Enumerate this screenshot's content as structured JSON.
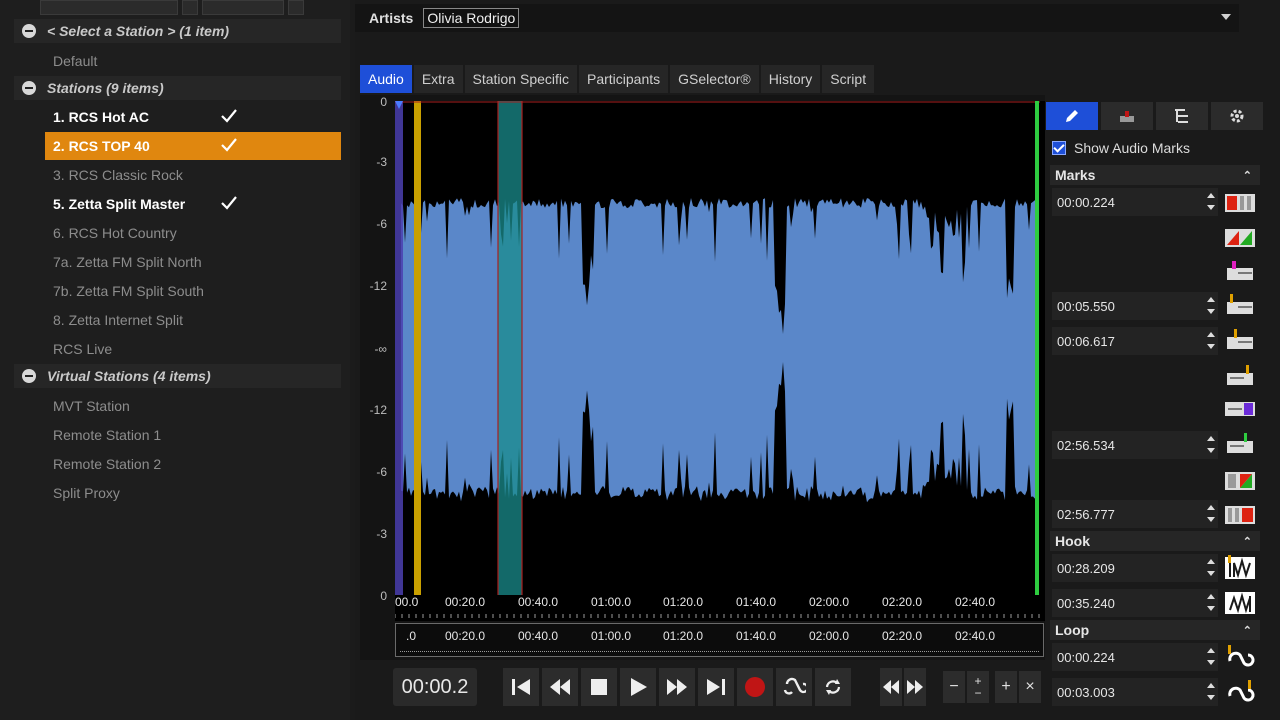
{
  "left_panel": {
    "group_select": "< Select a Station > (1 item)",
    "default_item": "Default",
    "group_stations": "Stations (9 items)",
    "stations": [
      {
        "label": "1. RCS Hot AC",
        "checked": true
      },
      {
        "label": "2. RCS TOP 40",
        "checked": true,
        "selected": true
      },
      {
        "label": "3. RCS Classic Rock",
        "checked": false
      },
      {
        "label": "5. Zetta Split Master",
        "checked": true
      },
      {
        "label": "6. RCS Hot Country",
        "checked": false
      },
      {
        "label": "7a. Zetta FM Split North",
        "checked": false
      },
      {
        "label": "7b. Zetta FM Split South",
        "checked": false
      },
      {
        "label": "8. Zetta Internet Split",
        "checked": false
      },
      {
        "label": "RCS Live",
        "checked": false
      }
    ],
    "group_virtual": "Virtual Stations (4 items)",
    "virtual_stations": [
      "MVT Station",
      "Remote Station 1",
      "Remote Station 2",
      "Split Proxy"
    ]
  },
  "artists": {
    "label": "Artists",
    "value": "Olivia Rodrigo"
  },
  "tabs": [
    "Audio",
    "Extra",
    "Station Specific",
    "Participants",
    "GSelector®",
    "History",
    "Script"
  ],
  "active_tab": "Audio",
  "waveform": {
    "y_labels": [
      "0",
      "-3",
      "-6",
      "-12",
      "-∞",
      "-12",
      "-6",
      "-3",
      "0"
    ],
    "time_labels": [
      "00.0",
      "00:20.0",
      "00:40.0",
      "01:00.0",
      "01:20.0",
      "01:40.0",
      "02:00.0",
      "02:20.0",
      "02:40.0"
    ],
    "lower_time_labels": [
      ".0",
      "00:20.0",
      "00:40.0",
      "01:00.0",
      "01:20.0",
      "01:40.0",
      "02:00.0",
      "02:20.0",
      "02:40.0"
    ],
    "colors": {
      "wave": "#5a87c9",
      "hook": "#1a8c8c",
      "loop": "#c9a000",
      "end": "#2ecc40",
      "boundary": "#aa1f1f"
    }
  },
  "transport": {
    "time": "00:00.2",
    "zoom_minus": "−",
    "zoom_plus": "+",
    "zoom_plus_small": "+",
    "zoom_minus_small": "−",
    "close": "×"
  },
  "right_panel": {
    "show_audio_marks": "Show Audio Marks",
    "marks_header": "Marks",
    "marks": [
      "00:00.224",
      "00:05.550",
      "00:06.617",
      "02:56.534",
      "02:56.777"
    ],
    "hook_header": "Hook",
    "hooks": [
      "00:28.209",
      "00:35.240"
    ],
    "loop_header": "Loop",
    "loops": [
      "00:00.224",
      "00:03.003"
    ]
  }
}
